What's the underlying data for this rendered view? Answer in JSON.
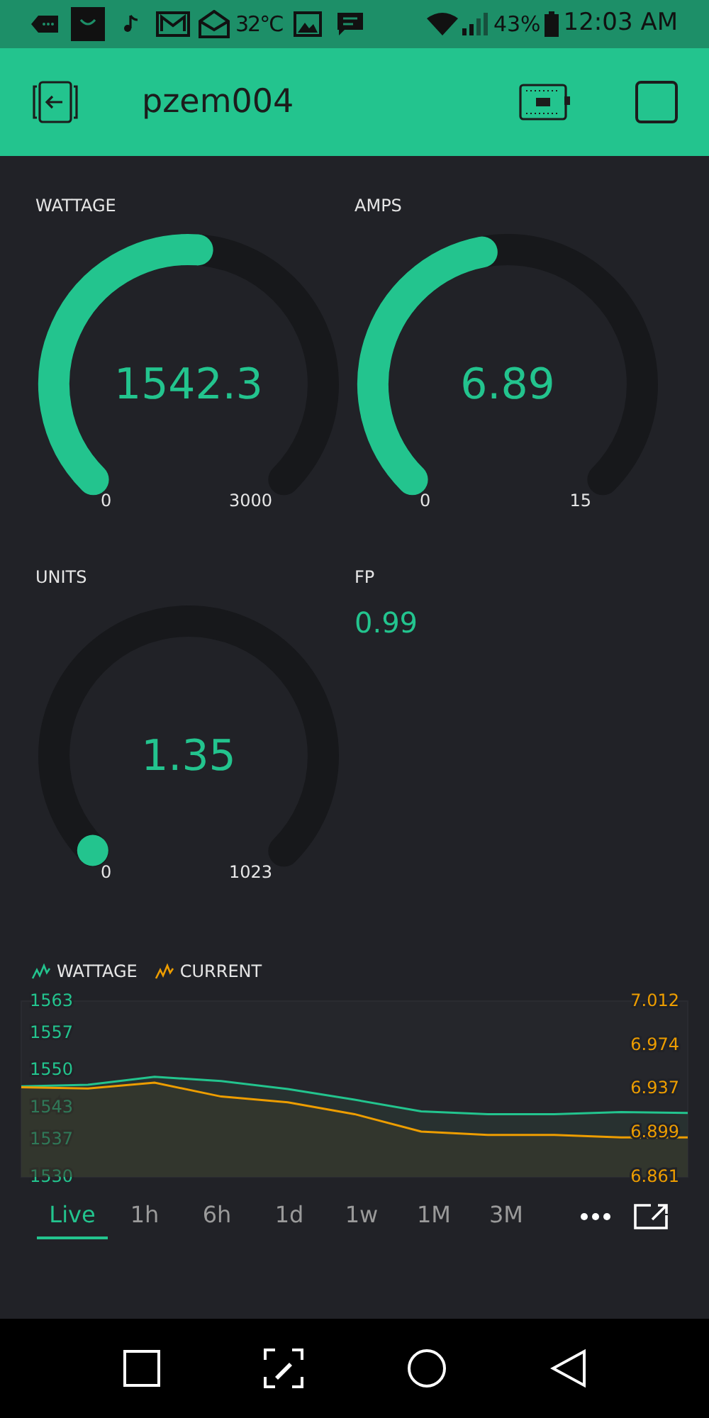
{
  "status_bar": {
    "temperature": "32°C",
    "battery": "43%",
    "time": "12:03 AM"
  },
  "header": {
    "title": "pzem004"
  },
  "widgets": [
    {
      "kind": "gauge",
      "label": "WATTAGE",
      "value": "1542.3",
      "min": "0",
      "max": "3000"
    },
    {
      "kind": "gauge",
      "label": "AMPS",
      "value": "6.89",
      "min": "0",
      "max": "15"
    },
    {
      "kind": "gauge",
      "label": "UNITS",
      "value": "1.35",
      "min": "0",
      "max": "1023"
    },
    {
      "kind": "value",
      "label": "FP",
      "value": "0.99"
    }
  ],
  "chart": {
    "layers": [
      {
        "chart_data": {
          "type": "line",
          "series": [
            {
              "name": "WATTAGE",
              "color": "#23c48e",
              "values": [
                1547,
                1547.3,
                1548.8,
                1548,
                1546.5,
                1544.5,
                1542.3,
                1541.8,
                1541.8,
                1542.2,
                1542
              ]
            }
          ],
          "ylim": [
            1530,
            1563
          ],
          "yticks": [
            1563,
            1557,
            1550,
            1543,
            1537,
            1530
          ]
        }
      },
      {
        "chart_data": {
          "type": "line",
          "series": [
            {
              "name": "CURRENT",
              "color": "#ed9d00",
              "values": [
                6.938,
                6.937,
                6.942,
                6.93,
                6.925,
                6.915,
                6.9,
                6.897,
                6.897,
                6.895,
                6.895
              ]
            }
          ],
          "ylim": [
            6.861,
            7.012
          ],
          "yticks": [
            {
              "value": 7.012,
              "label": "7.012"
            },
            {
              "value": 6.974,
              "label": "6.974"
            },
            {
              "value": 6.937,
              "label": "6.937"
            },
            {
              "value": 6.899,
              "label": "6.899"
            },
            {
              "value": 6.861,
              "label": "6.861"
            }
          ]
        }
      }
    ],
    "periods": [
      {
        "label": "Live",
        "selected": true
      },
      {
        "label": "1h",
        "selected": false
      },
      {
        "label": "6h",
        "selected": false
      },
      {
        "label": "1d",
        "selected": false
      },
      {
        "label": "1w",
        "selected": false
      },
      {
        "label": "1M",
        "selected": false
      },
      {
        "label": "3M",
        "selected": false
      }
    ]
  }
}
